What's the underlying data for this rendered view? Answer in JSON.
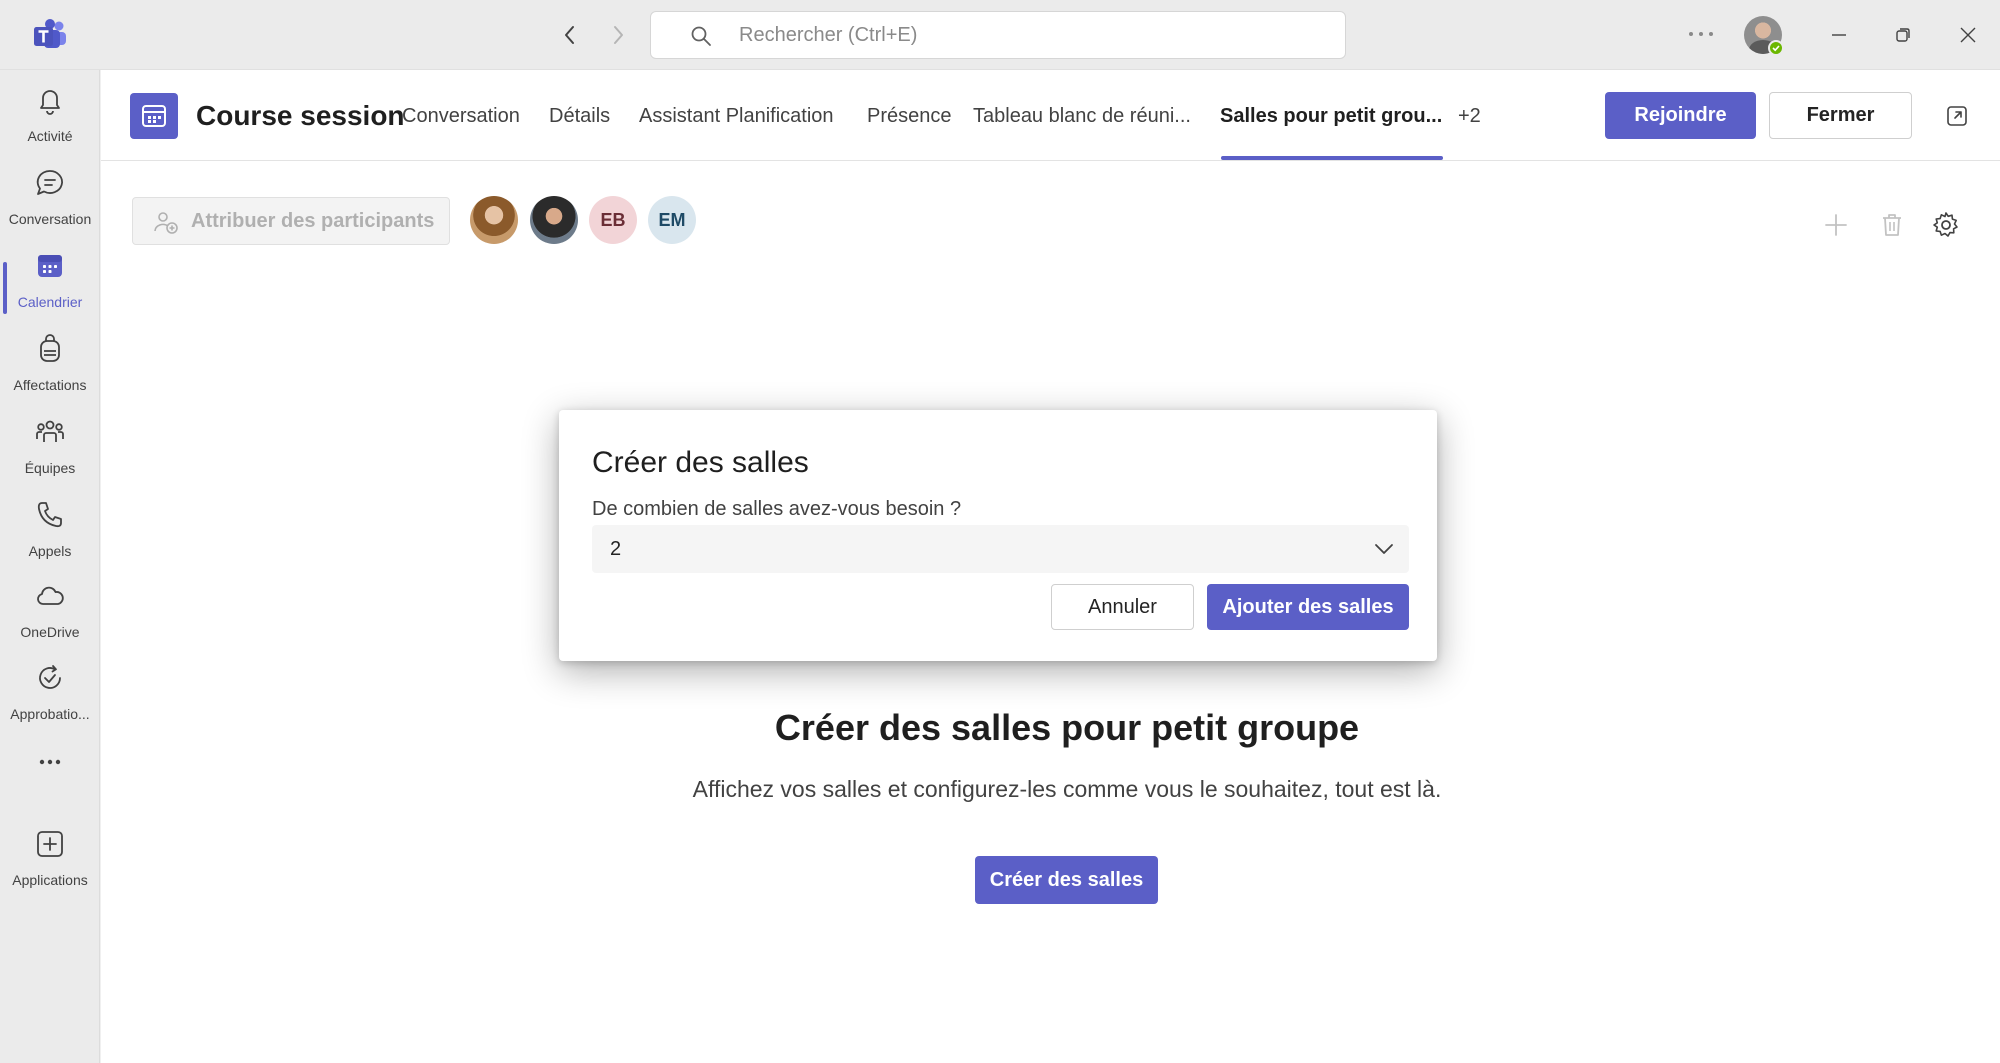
{
  "colors": {
    "brand": "#5b5fc7",
    "presence": "#6bb700",
    "rail_bg": "#ebebeb",
    "main_bg": "#ffffff"
  },
  "titlebar": {
    "app_icon": "teams-logo-icon",
    "search_placeholder": "Rechercher (Ctrl+E)",
    "icons": [
      "chevron-left-icon",
      "chevron-right-icon",
      "search-icon",
      "more-icon",
      "minimize-icon",
      "maximize-icon",
      "close-icon"
    ]
  },
  "rail": {
    "items": [
      {
        "label": "Activité",
        "icon": "bell-icon"
      },
      {
        "label": "Conversation",
        "icon": "chat-icon"
      },
      {
        "label": "Calendrier",
        "icon": "calendar-icon",
        "active": true
      },
      {
        "label": "Affectations",
        "icon": "backpack-icon"
      },
      {
        "label": "Équipes",
        "icon": "people-icon"
      },
      {
        "label": "Appels",
        "icon": "phone-icon"
      },
      {
        "label": "OneDrive",
        "icon": "cloud-icon"
      },
      {
        "label": "Approbatio...",
        "icon": "approvals-icon"
      },
      {
        "label": "",
        "icon": "more-icon"
      },
      {
        "label": "Applications",
        "icon": "add-app-icon"
      }
    ]
  },
  "meeting": {
    "title": "Course session",
    "tabs": [
      {
        "label": "Conversation"
      },
      {
        "label": "Détails"
      },
      {
        "label": "Assistant Planification"
      },
      {
        "label": "Présence"
      },
      {
        "label": "Tableau blanc de réuni..."
      },
      {
        "label": "Salles pour petit grou...",
        "active": true
      },
      {
        "label": "+2"
      }
    ],
    "join_label": "Rejoindre",
    "close_label": "Fermer"
  },
  "toolbar": {
    "assign_label": "Attribuer des participants",
    "participants": [
      {
        "initials": ""
      },
      {
        "initials": ""
      },
      {
        "initials": "EB"
      },
      {
        "initials": "EM"
      }
    ]
  },
  "empty_state": {
    "title": "Créer des salles pour petit groupe",
    "subtitle": "Affichez vos salles et configurez-les comme vous le souhaitez, tout est là.",
    "button_label": "Créer des salles"
  },
  "dialog": {
    "title": "Créer des salles",
    "question": "De combien de salles avez-vous besoin ?",
    "selected_value": "2",
    "cancel_label": "Annuler",
    "confirm_label": "Ajouter des salles"
  }
}
